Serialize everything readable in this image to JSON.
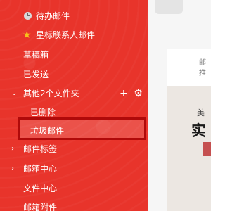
{
  "colors": {
    "sidebar_bg": "#e8342b",
    "highlight_border": "#b00a0a",
    "star": "#f6c21c"
  },
  "sidebar": {
    "items": [
      {
        "label": "待办邮件",
        "icon": "clock-icon"
      },
      {
        "label": "星标联系人邮件",
        "icon": "star-icon"
      },
      {
        "label": "草稿箱"
      },
      {
        "label": "已发送"
      },
      {
        "label": "其他2个文件夹",
        "icon": "chevron-down-icon",
        "actions": [
          "+",
          "⚙"
        ]
      },
      {
        "label": "已删除"
      },
      {
        "label": "垃圾邮件",
        "selected": true
      },
      {
        "label": "邮件标签",
        "icon": "chevron-right-icon"
      },
      {
        "label": "邮箱中心",
        "icon": "chevron-right-icon"
      },
      {
        "label": "文件中心"
      },
      {
        "label": "邮箱附件"
      }
    ]
  },
  "main": {
    "panel_tab": "邮推",
    "ad_line1": "美",
    "ad_line2": "实"
  }
}
